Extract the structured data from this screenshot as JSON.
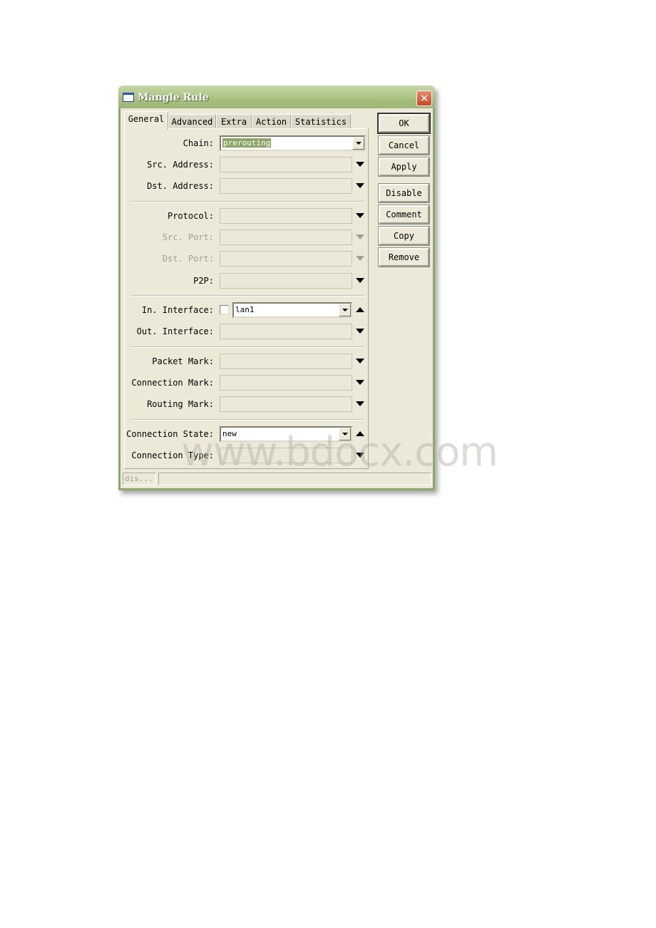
{
  "window": {
    "title": "Mangle Rule",
    "close_label": "✕"
  },
  "tabs": [
    {
      "label": "General",
      "active": true
    },
    {
      "label": "Advanced"
    },
    {
      "label": "Extra"
    },
    {
      "label": "Action"
    },
    {
      "label": "Statistics"
    }
  ],
  "fields": {
    "chain": {
      "label": "Chain:",
      "value": "prerouting"
    },
    "src_address": {
      "label": "Src. Address:",
      "value": ""
    },
    "dst_address": {
      "label": "Dst. Address:",
      "value": ""
    },
    "protocol": {
      "label": "Protocol:",
      "value": ""
    },
    "src_port": {
      "label": "Src. Port:",
      "value": "",
      "disabled": true
    },
    "dst_port": {
      "label": "Dst. Port:",
      "value": "",
      "disabled": true
    },
    "p2p": {
      "label": "P2P:",
      "value": ""
    },
    "in_interface": {
      "label": "In. Interface:",
      "value": "lan1",
      "negate_checked": false
    },
    "out_interface": {
      "label": "Out. Interface:",
      "value": ""
    },
    "packet_mark": {
      "label": "Packet Mark:",
      "value": ""
    },
    "connection_mark": {
      "label": "Connection Mark:",
      "value": ""
    },
    "routing_mark": {
      "label": "Routing Mark:",
      "value": ""
    },
    "connection_state": {
      "label": "Connection State:",
      "value": "new"
    },
    "connection_type": {
      "label": "Connection Type:",
      "value": ""
    }
  },
  "buttons": {
    "ok": "OK",
    "cancel": "Cancel",
    "apply": "Apply",
    "disable": "Disable",
    "comment": "Comment",
    "copy": "Copy",
    "remove": "Remove"
  },
  "status_bar": {
    "left": "dis...",
    "right": ""
  },
  "watermark": "www.bdocx.com"
}
